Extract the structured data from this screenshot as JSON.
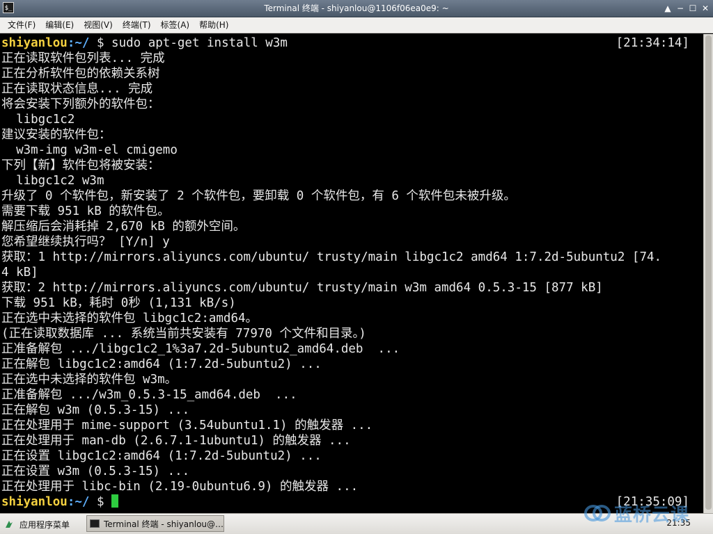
{
  "window": {
    "title": "Terminal 终端 - shiyanlou@1106f06ea0e9: ~",
    "icon": "terminal-icon",
    "controls": [
      "▲",
      "−",
      "☐",
      "✕"
    ]
  },
  "menu": {
    "items": [
      "文件(F)",
      "编辑(E)",
      "视图(V)",
      "终端(T)",
      "标签(A)",
      "帮助(H)"
    ]
  },
  "terminal": {
    "prompt_user": "shiyanlou",
    "prompt_path": ":~/",
    "prompt_symbol": " $ ",
    "command": "sudo apt-get install w3m",
    "command_time": "[21:34:14]",
    "output": [
      "正在读取软件包列表... 完成",
      "正在分析软件包的依赖关系树",
      "正在读取状态信息... 完成",
      "将会安装下列额外的软件包：",
      "  libgc1c2",
      "建议安装的软件包：",
      "  w3m-img w3m-el cmigemo",
      "下列【新】软件包将被安装：",
      "  libgc1c2 w3m",
      "升级了 0 个软件包，新安装了 2 个软件包，要卸载 0 个软件包，有 6 个软件包未被升级。",
      "需要下载 951 kB 的软件包。",
      "解压缩后会消耗掉 2,670 kB 的额外空间。",
      "您希望继续执行吗？ [Y/n] y",
      "获取：1 http://mirrors.aliyuncs.com/ubuntu/ trusty/main libgc1c2 amd64 1:7.2d-5ubuntu2 [74.",
      "4 kB]",
      "获取：2 http://mirrors.aliyuncs.com/ubuntu/ trusty/main w3m amd64 0.5.3-15 [877 kB]",
      "下载 951 kB，耗时 0秒 (1,131 kB/s)",
      "正在选中未选择的软件包 libgc1c2:amd64。",
      "(正在读取数据库 ... 系统当前共安装有 77970 个文件和目录。)",
      "正准备解包 .../libgc1c2_1%3a7.2d-5ubuntu2_amd64.deb  ...",
      "正在解包 libgc1c2:amd64 (1:7.2d-5ubuntu2) ...",
      "正在选中未选择的软件包 w3m。",
      "正准备解包 .../w3m_0.5.3-15_amd64.deb  ...",
      "正在解包 w3m (0.5.3-15) ...",
      "正在处理用于 mime-support (3.54ubuntu1.1) 的触发器 ...",
      "正在处理用于 man-db (2.6.7.1-1ubuntu1) 的触发器 ...",
      "正在设置 libgc1c2:amd64 (1:7.2d-5ubuntu2) ...",
      "正在设置 w3m (0.5.3-15) ...",
      "正在处理用于 libc-bin (2.19-0ubuntu6.9) 的触发器 ..."
    ],
    "final_time": "[21:35:09]"
  },
  "taskbar": {
    "start_label": "应用程序菜单",
    "start_icon": "app-menu-icon",
    "task_label": "Terminal 终端 - shiyanlou@…",
    "clock": "21:35"
  },
  "watermark": {
    "text": "蓝桥云课"
  },
  "colors": {
    "prompt_user": "#f4d03f",
    "prompt_path": "#5fb0ff",
    "cursor": "#2ecc40",
    "terminal_bg": "#000000",
    "terminal_fg": "#e8e8e8"
  }
}
